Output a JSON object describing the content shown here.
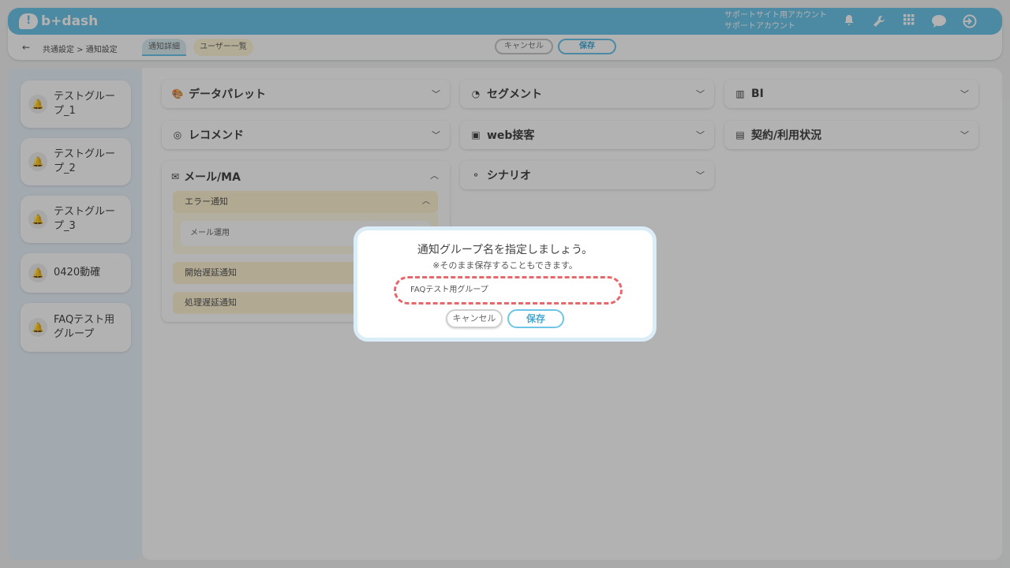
{
  "header": {
    "logo_text": "b+dash",
    "account_line1": "サポートサイト用アカウント",
    "account_line2": "サポートアカウント",
    "icons": [
      "bell-icon",
      "wrench-icon",
      "grid-icon",
      "chat-icon",
      "logout-icon"
    ]
  },
  "subheader": {
    "back_arrow": "←",
    "breadcrumb": "共通設定 > 通知設定",
    "tab_detail": "通知詳細",
    "tab_users": "ユーザー一覧",
    "cancel_label": "キャンセル",
    "save_label": "保存"
  },
  "sidebar": {
    "groups": [
      {
        "label": "テストグループ_1"
      },
      {
        "label": "テストグループ_2"
      },
      {
        "label": "テストグループ_3"
      },
      {
        "label": "0420動確"
      },
      {
        "label": "FAQテスト用グループ"
      }
    ]
  },
  "main": {
    "cards": [
      {
        "label": "データパレット",
        "icon": "palette-icon"
      },
      {
        "label": "セグメント",
        "icon": "segment-icon"
      },
      {
        "label": "BI",
        "icon": "chart-icon"
      },
      {
        "label": "レコメンド",
        "icon": "recommend-icon"
      },
      {
        "label": "web接客",
        "icon": "web-icon"
      },
      {
        "label": "契約/利用状況",
        "icon": "contract-icon"
      },
      {
        "label": "シナリオ",
        "icon": "scenario-icon"
      }
    ],
    "mail": {
      "label": "メール/MA",
      "error_label": "エラー通知",
      "error_item": "メール運用",
      "start_delay": "開始遅延通知",
      "process_delay": "処理遅延通知"
    }
  },
  "modal": {
    "title": "通知グループ名を指定しましょう。",
    "note": "※そのまま保存することもできます。",
    "input_value": "FAQテスト用グループ",
    "cancel_label": "キャンセル",
    "save_label": "保存"
  },
  "colors": {
    "accent": "#6ec5e8",
    "highlight_dash": "#e5686c",
    "sub_bg": "#fff3d2"
  }
}
